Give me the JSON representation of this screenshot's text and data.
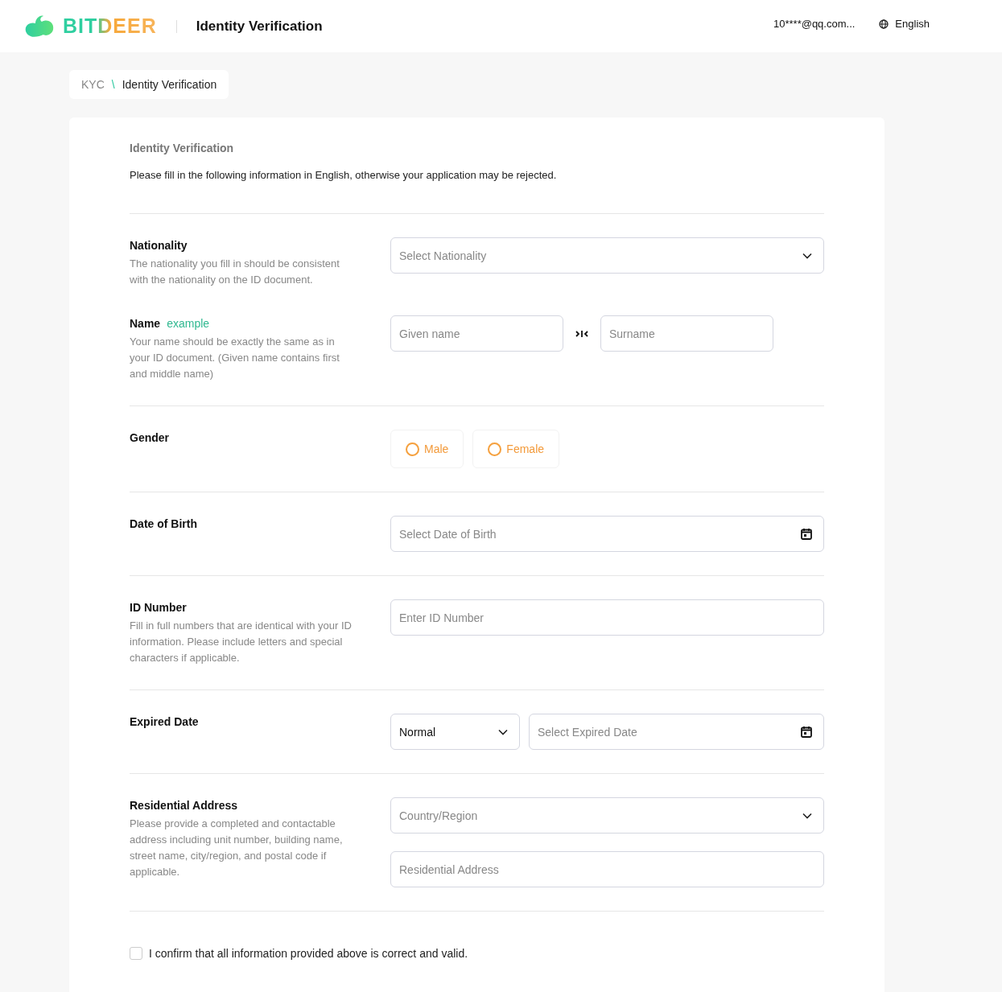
{
  "header": {
    "brand": "BITDEER",
    "page_title": "Identity Verification",
    "account": "10****@qq.com...",
    "language": "English"
  },
  "breadcrumb": {
    "separator": "\\",
    "items": [
      {
        "label": "KYC",
        "current": false
      },
      {
        "label": "Identity Verification",
        "current": true
      }
    ]
  },
  "form": {
    "title": "Identity Verification",
    "intro": "Please fill in the following information in English, otherwise your application may be rejected.",
    "groups": [
      {
        "sections": [
          {
            "label": "Nationality",
            "description": "The nationality you fill in should be consistent with the nationality on the ID document.",
            "rows": [
              [
                {
                  "kind": "select",
                  "placeholder": "Select Nationality"
                }
              ]
            ]
          },
          {
            "label": "Name",
            "link": "example",
            "description": "Your name should be exactly the same as in your ID document. (Given name contains first and middle name)",
            "rows": [
              [
                {
                  "kind": "text",
                  "placeholder": "Given name"
                },
                {
                  "kind": "swap"
                },
                {
                  "kind": "text",
                  "placeholder": "Surname"
                }
              ]
            ]
          }
        ]
      },
      {
        "sections": [
          {
            "label": "Gender",
            "rows": [
              [
                {
                  "kind": "radio",
                  "label": "Male",
                  "selected": false
                },
                {
                  "kind": "radio",
                  "label": "Female",
                  "selected": false
                }
              ]
            ]
          }
        ]
      },
      {
        "sections": [
          {
            "label": "Date of Birth",
            "rows": [
              [
                {
                  "kind": "date",
                  "placeholder": "Select Date of Birth"
                }
              ]
            ]
          }
        ]
      },
      {
        "sections": [
          {
            "label": "ID Number",
            "description": "Fill in full numbers that are identical with your ID information. Please include letters and special characters if applicable.",
            "rows": [
              [
                {
                  "kind": "text",
                  "placeholder": "Enter ID Number"
                }
              ]
            ]
          }
        ]
      },
      {
        "sections": [
          {
            "label": "Expired Date",
            "rows": [
              [
                {
                  "kind": "select",
                  "value": "Normal"
                },
                {
                  "kind": "date",
                  "placeholder": "Select Expired Date"
                }
              ]
            ]
          }
        ]
      },
      {
        "sections": [
          {
            "label": "Residential Address",
            "description": "Please provide a completed and contactable address including unit number, building name, street name, city/region, and postal code if applicable.",
            "rows": [
              [
                {
                  "kind": "select",
                  "placeholder": "Country/Region"
                }
              ],
              [
                {
                  "kind": "text",
                  "placeholder": "Residential Address"
                }
              ]
            ]
          }
        ]
      }
    ],
    "confirm": {
      "label": "I confirm that all information provided above is correct and valid.",
      "checked": false
    }
  }
}
